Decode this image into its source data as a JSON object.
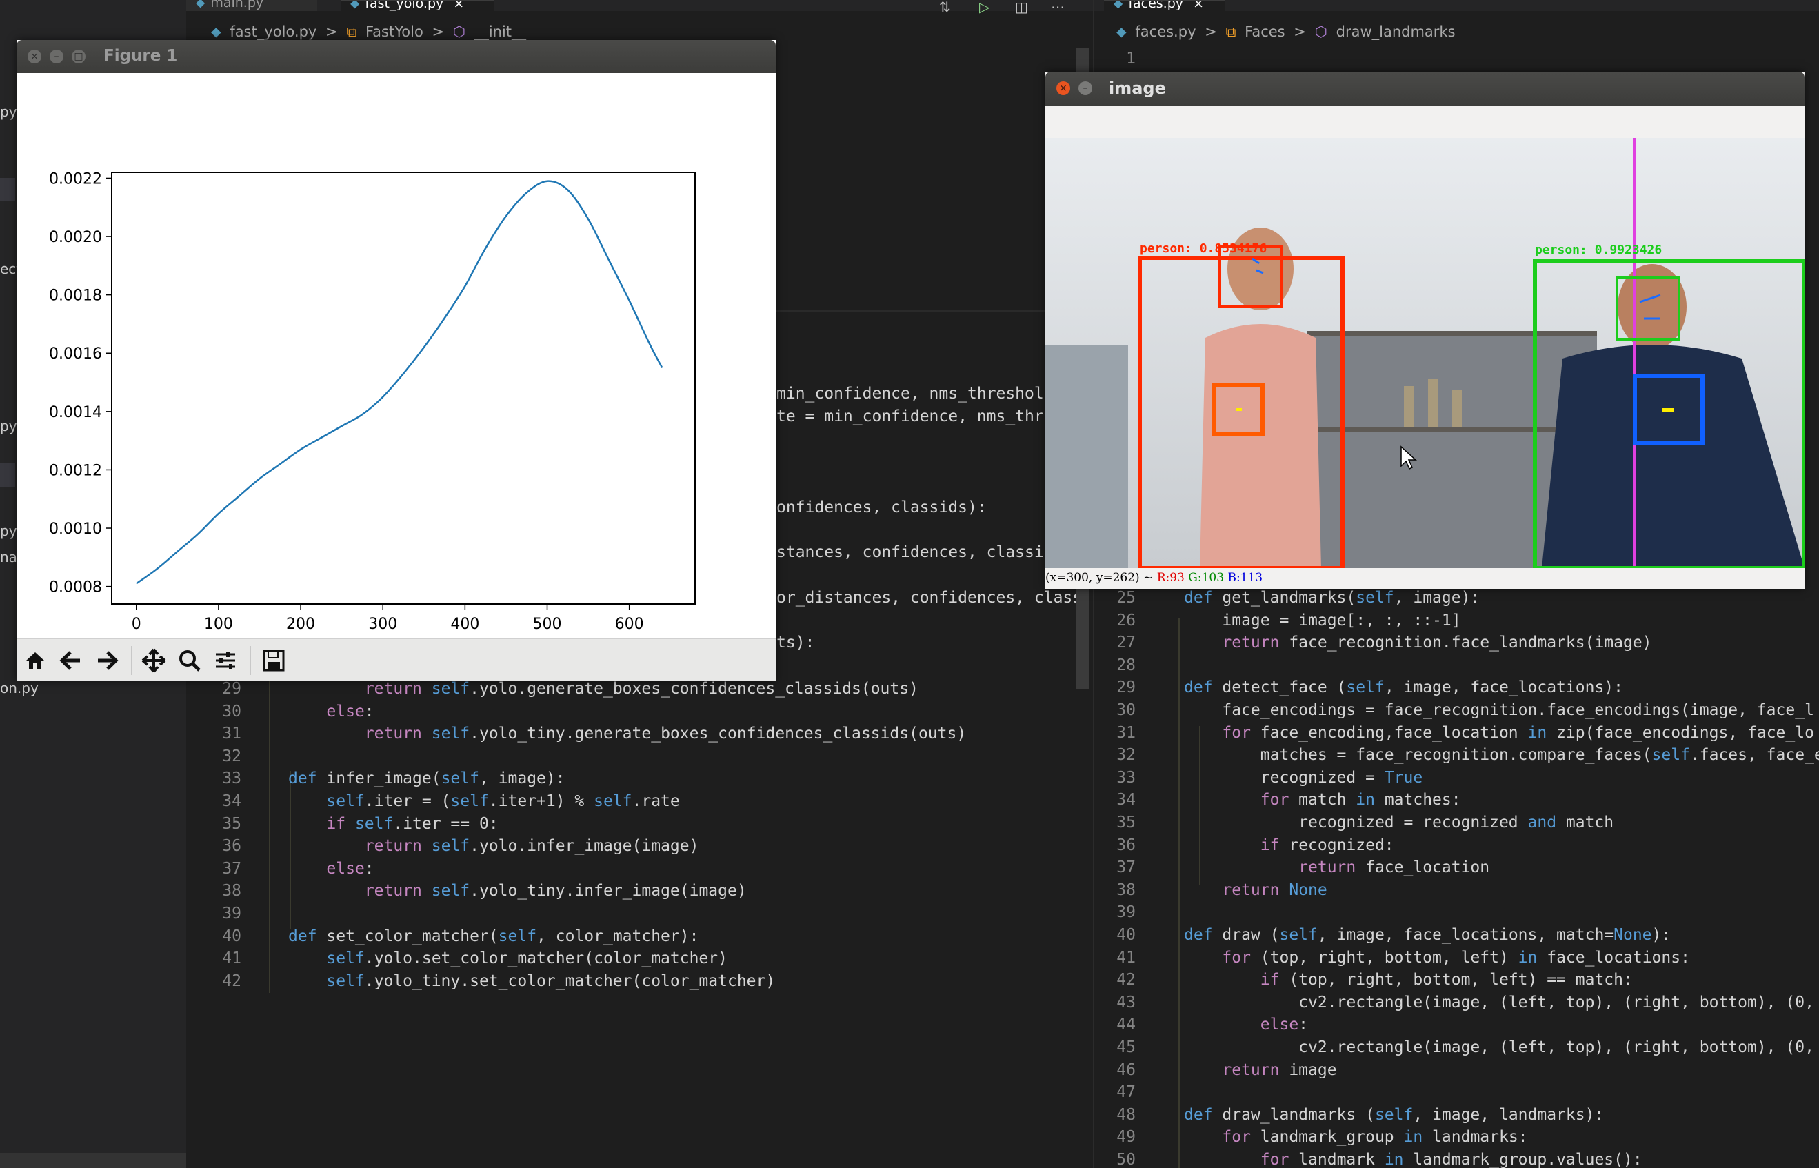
{
  "sidebar": {
    "fragments": [
      "py",
      "ect",
      "py",
      "py",
      "na",
      "on.py"
    ]
  },
  "left_editor": {
    "tabs": [
      {
        "label": "main.py",
        "active": false
      },
      {
        "label": "fast_yolo.py",
        "active": true,
        "close": "×"
      }
    ],
    "breadcrumb": [
      "fast_yolo.py",
      ">",
      "FastYolo",
      ">",
      "__init__"
    ],
    "partial_lines": [
      {
        "text": "min_confidence, nms_threshol"
      },
      {
        "text": "te = min_confidence, nms_thr"
      },
      {
        "text": "onfidences, classids):"
      },
      {
        "text": "stances, confidences, classi"
      },
      {
        "text": "or_distances, confidences, class"
      },
      {
        "text": "ts):"
      }
    ],
    "lines": [
      {
        "num": "29",
        "text": "        return self.yolo.generate_boxes_confidences_classids(outs)"
      },
      {
        "num": "30",
        "text": "    else:"
      },
      {
        "num": "31",
        "text": "        return self.yolo_tiny.generate_boxes_confidences_classids(outs)"
      },
      {
        "num": "32",
        "text": ""
      },
      {
        "num": "33",
        "text": "def infer_image(self, image):"
      },
      {
        "num": "34",
        "text": "    self.iter = (self.iter+1) % self.rate"
      },
      {
        "num": "35",
        "text": "    if self.iter == 0:"
      },
      {
        "num": "36",
        "text": "        return self.yolo.infer_image(image)"
      },
      {
        "num": "37",
        "text": "    else:"
      },
      {
        "num": "38",
        "text": "        return self.yolo_tiny.infer_image(image)"
      },
      {
        "num": "39",
        "text": ""
      },
      {
        "num": "40",
        "text": "def set_color_matcher(self, color_matcher):"
      },
      {
        "num": "41",
        "text": "    self.yolo.set_color_matcher(color_matcher)"
      },
      {
        "num": "42",
        "text": "    self.yolo_tiny.set_color_matcher(color_matcher)"
      }
    ]
  },
  "right_editor": {
    "tabs": [
      {
        "label": "faces.py",
        "active": true,
        "close": "×"
      }
    ],
    "breadcrumb": [
      "faces.py",
      ">",
      "Faces",
      ">",
      "draw_landmarks"
    ],
    "first_line_num": "1",
    "lines": [
      {
        "num": "25",
        "text": "def get_landmarks(self, image):"
      },
      {
        "num": "26",
        "text": "    image = image[:, :, ::-1]"
      },
      {
        "num": "27",
        "text": "    return face_recognition.face_landmarks(image)"
      },
      {
        "num": "28",
        "text": ""
      },
      {
        "num": "29",
        "text": "def detect_face (self, image, face_locations):"
      },
      {
        "num": "30",
        "text": "    face_encodings = face_recognition.face_encodings(image, face_l"
      },
      {
        "num": "31",
        "text": "    for face_encoding,face_location in zip(face_encodings, face_lo"
      },
      {
        "num": "32",
        "text": "        matches = face_recognition.compare_faces(self.faces, face_en"
      },
      {
        "num": "33",
        "text": "        recognized = True"
      },
      {
        "num": "34",
        "text": "        for match in matches:"
      },
      {
        "num": "35",
        "text": "            recognized = recognized and match"
      },
      {
        "num": "36",
        "text": "        if recognized:"
      },
      {
        "num": "37",
        "text": "            return face_location"
      },
      {
        "num": "38",
        "text": "    return None"
      },
      {
        "num": "39",
        "text": ""
      },
      {
        "num": "40",
        "text": "def draw (self, image, face_locations, match=None):"
      },
      {
        "num": "41",
        "text": "    for (top, right, bottom, left) in face_locations:"
      },
      {
        "num": "42",
        "text": "        if (top, right, bottom, left) == match:"
      },
      {
        "num": "43",
        "text": "            cv2.rectangle(image, (left, top), (right, bottom), (0, 255"
      },
      {
        "num": "44",
        "text": "        else:"
      },
      {
        "num": "45",
        "text": "            cv2.rectangle(image, (left, top), (right, bottom), (0, 0,"
      },
      {
        "num": "46",
        "text": "    return image"
      },
      {
        "num": "47",
        "text": ""
      },
      {
        "num": "48",
        "text": "def draw_landmarks (self, image, landmarks):"
      },
      {
        "num": "49",
        "text": "    for landmark_group in landmarks:"
      },
      {
        "num": "50",
        "text": "        for landmark in landmark_group.values():"
      }
    ]
  },
  "figure_window": {
    "title": "Figure 1",
    "toolbar_icons": [
      "home-icon",
      "back-icon",
      "forward-icon",
      "pan-icon",
      "zoom-icon",
      "configure-subplots-icon",
      "save-icon"
    ]
  },
  "chart_data": {
    "type": "line",
    "title": "",
    "xlabel": "",
    "ylabel": "",
    "xlim": [
      -30,
      680
    ],
    "ylim": [
      0.00074,
      0.00222
    ],
    "xticks": [
      0,
      100,
      200,
      300,
      400,
      500,
      600
    ],
    "xtick_labels": [
      "0",
      "100",
      "200",
      "300",
      "400",
      "500",
      "600"
    ],
    "yticks": [
      0.0008,
      0.001,
      0.0012,
      0.0014,
      0.0016,
      0.0018,
      0.002,
      0.0022
    ],
    "ytick_labels": [
      "0.0008",
      "0.0010",
      "0.0012",
      "0.0014",
      "0.0016",
      "0.0018",
      "0.0020",
      "0.0022"
    ],
    "grid": false,
    "color": "#1f77b4",
    "series": [
      {
        "x": [
          0,
          25,
          50,
          75,
          100,
          125,
          150,
          175,
          200,
          225,
          250,
          275,
          300,
          325,
          350,
          375,
          400,
          425,
          450,
          475,
          500,
          525,
          550,
          575,
          600,
          625,
          640
        ],
        "values": [
          0.00081,
          0.00086,
          0.00092,
          0.00098,
          0.00105,
          0.00111,
          0.00117,
          0.00122,
          0.00127,
          0.00131,
          0.00135,
          0.00139,
          0.00145,
          0.00153,
          0.00162,
          0.00172,
          0.00183,
          0.00196,
          0.00207,
          0.00215,
          0.00219,
          0.00216,
          0.00206,
          0.00192,
          0.00178,
          0.00163,
          0.00155
        ]
      }
    ]
  },
  "image_window": {
    "title": "image",
    "status": {
      "coords": "(x=300, y=262) ~",
      "r": "R:93",
      "g": "G:103",
      "b": "B:113"
    },
    "detections": [
      {
        "label": "person: 0.8534176",
        "color": "#ff2a00"
      },
      {
        "label": "person: 0.9923426",
        "color": "#1ccd1c"
      }
    ],
    "colors": {
      "red_box": "#ff2a00",
      "green_box": "#1ccd1c",
      "blue_box": "#1060ff",
      "orange_box": "#ff5a00",
      "magenta_line": "#e040e0"
    }
  }
}
